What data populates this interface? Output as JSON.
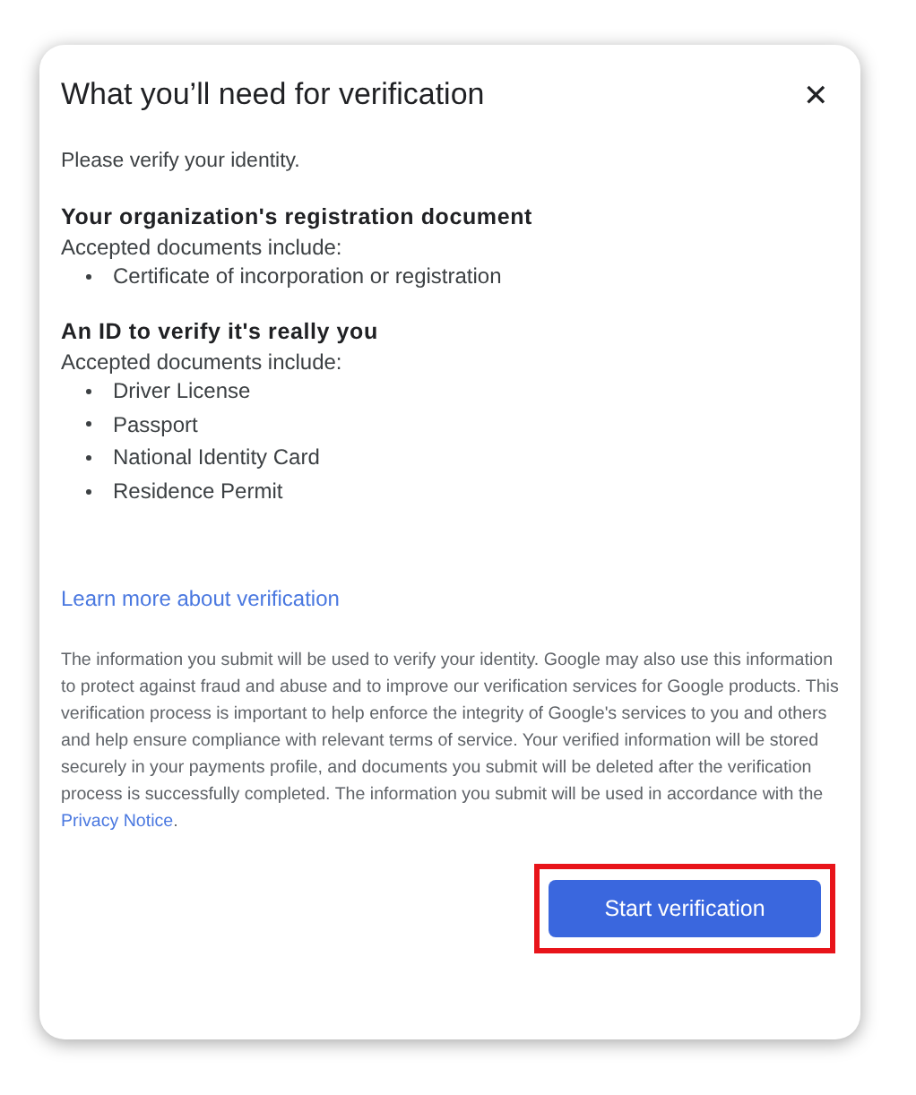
{
  "dialog": {
    "title": "What you’ll need for verification",
    "close_label": "✕",
    "intro": "Please verify your identity.",
    "sections": [
      {
        "heading": "Your organization's registration document",
        "subheading": "Accepted documents include:",
        "items": [
          "Certificate of incorporation or registration"
        ]
      },
      {
        "heading": "An ID to verify it's really you",
        "subheading": "Accepted documents include:",
        "items": [
          "Driver License",
          "Passport",
          "National Identity Card",
          "Residence Permit"
        ]
      }
    ],
    "learn_more_link": "Learn more about verification",
    "disclaimer": {
      "text": "The information you submit will be used to verify your identity. Google may also use this information to protect against fraud and abuse and to improve our verification services for Google products. This verification process is important to help enforce the integrity of Google's services to you and others and help ensure compliance with relevant terms of service. Your verified information will be stored securely in your payments profile, and documents you submit will be deleted after the verification process is successfully completed. The information you submit will be used in accordance with the",
      "link": "Privacy Notice",
      "end": "."
    },
    "button": {
      "label": "Start verification",
      "highlighted": true
    }
  }
}
